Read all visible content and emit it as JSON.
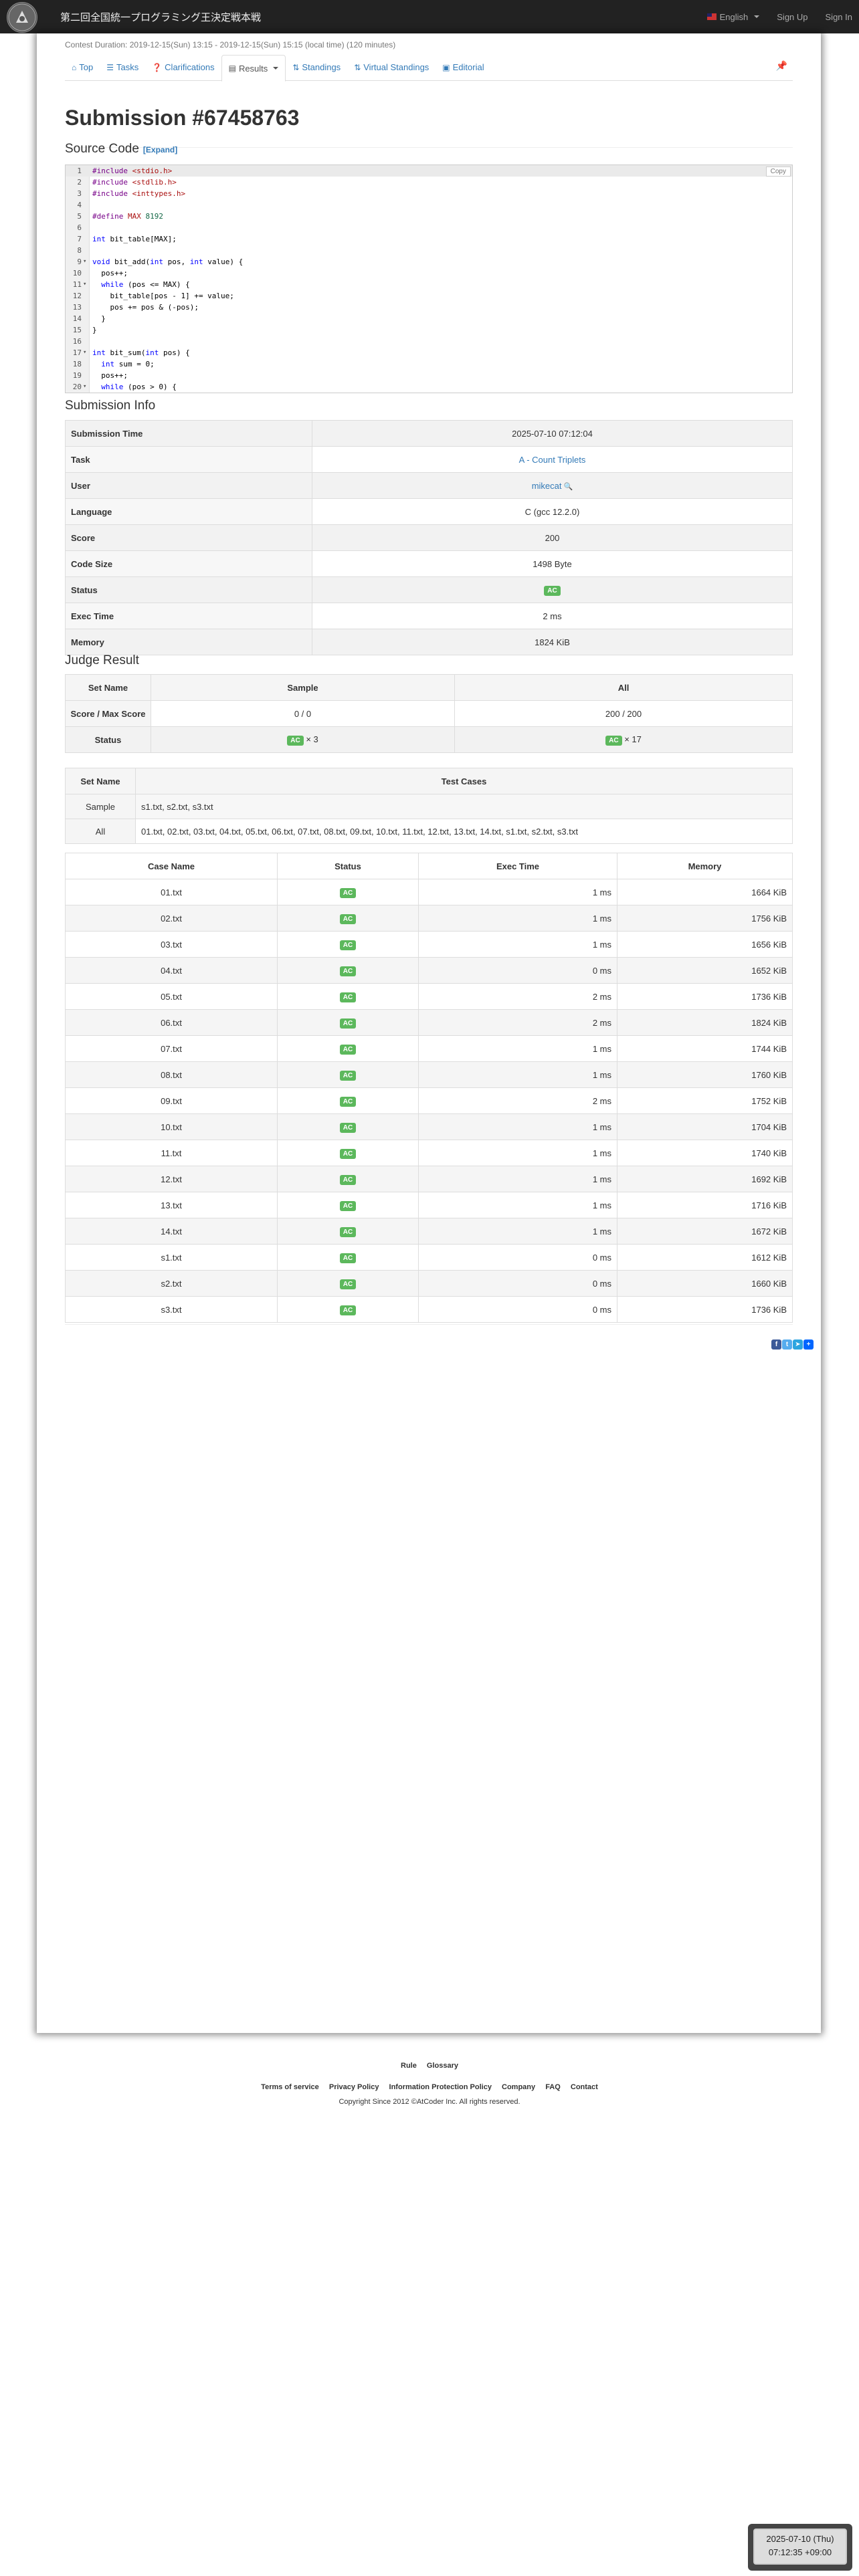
{
  "nav": {
    "brand": "第二回全国統一プログラミング王決定戦本戦",
    "language": "English",
    "sign_up": "Sign Up",
    "sign_in": "Sign In"
  },
  "contest": {
    "duration": "Contest Duration: 2019-12-15(Sun) 13:15 - 2019-12-15(Sun) 15:15 (local time) (120 minutes)"
  },
  "tabs": [
    {
      "label": "Top",
      "icon": "home-icon"
    },
    {
      "label": "Tasks",
      "icon": "list-icon"
    },
    {
      "label": "Clarifications",
      "icon": "question-icon"
    },
    {
      "label": "Results",
      "icon": "list-alt-icon"
    },
    {
      "label": "Standings",
      "icon": "sort-icon"
    },
    {
      "label": "Virtual Standings",
      "icon": "sort-icon"
    },
    {
      "label": "Editorial",
      "icon": "book-icon"
    }
  ],
  "page": {
    "title": "Submission #67458763",
    "source_heading": "Source Code",
    "expand": "[Expand]",
    "copy": "Copy",
    "info_heading": "Submission Info",
    "judge_heading": "Judge Result"
  },
  "code_lines": [
    "#include <stdio.h>",
    "#include <stdlib.h>",
    "#include <inttypes.h>",
    "",
    "#define MAX 8192",
    "",
    "int bit_table[MAX];",
    "",
    "void bit_add(int pos, int value) {",
    "  pos++;",
    "  while (pos <= MAX) {",
    "    bit_table[pos - 1] += value;",
    "    pos += pos & (-pos);",
    "  }",
    "}",
    "",
    "int bit_sum(int pos) {",
    "  int sum = 0;",
    "  pos++;",
    "  while (pos > 0) {"
  ],
  "submission_info": {
    "rows": [
      {
        "label": "Submission Time",
        "value": "2025-07-10 07:12:04"
      },
      {
        "label": "Task",
        "value": "A - Count Triplets"
      },
      {
        "label": "User",
        "value": "mikecat"
      },
      {
        "label": "Language",
        "value": "C (gcc 12.2.0)"
      },
      {
        "label": "Score",
        "value": "200"
      },
      {
        "label": "Code Size",
        "value": "1498 Byte"
      },
      {
        "label": "Status",
        "value": "AC"
      },
      {
        "label": "Exec Time",
        "value": "2 ms"
      },
      {
        "label": "Memory",
        "value": "1824 KiB"
      }
    ]
  },
  "judge": {
    "headers": [
      "Set Name",
      "Sample",
      "All"
    ],
    "score_label": "Score / Max Score",
    "sample_score": "0 / 0",
    "all_score": "200 / 200",
    "status_label": "Status",
    "sample_status": "AC",
    "sample_count": "× 3",
    "all_status": "AC",
    "all_count": "× 17"
  },
  "sets": {
    "headers": [
      "Set Name",
      "Test Cases"
    ],
    "rows": [
      {
        "name": "Sample",
        "cases": "s1.txt, s2.txt, s3.txt"
      },
      {
        "name": "All",
        "cases": "01.txt, 02.txt, 03.txt, 04.txt, 05.txt, 06.txt, 07.txt, 08.txt, 09.txt, 10.txt, 11.txt, 12.txt, 13.txt, 14.txt, s1.txt, s2.txt, s3.txt"
      }
    ]
  },
  "cases": {
    "headers": [
      "Case Name",
      "Status",
      "Exec Time",
      "Memory"
    ],
    "rows": [
      {
        "name": "01.txt",
        "status": "AC",
        "time": "1 ms",
        "memory": "1664 KiB"
      },
      {
        "name": "02.txt",
        "status": "AC",
        "time": "1 ms",
        "memory": "1756 KiB"
      },
      {
        "name": "03.txt",
        "status": "AC",
        "time": "1 ms",
        "memory": "1656 KiB"
      },
      {
        "name": "04.txt",
        "status": "AC",
        "time": "0 ms",
        "memory": "1652 KiB"
      },
      {
        "name": "05.txt",
        "status": "AC",
        "time": "2 ms",
        "memory": "1736 KiB"
      },
      {
        "name": "06.txt",
        "status": "AC",
        "time": "2 ms",
        "memory": "1824 KiB"
      },
      {
        "name": "07.txt",
        "status": "AC",
        "time": "1 ms",
        "memory": "1744 KiB"
      },
      {
        "name": "08.txt",
        "status": "AC",
        "time": "1 ms",
        "memory": "1760 KiB"
      },
      {
        "name": "09.txt",
        "status": "AC",
        "time": "2 ms",
        "memory": "1752 KiB"
      },
      {
        "name": "10.txt",
        "status": "AC",
        "time": "1 ms",
        "memory": "1704 KiB"
      },
      {
        "name": "11.txt",
        "status": "AC",
        "time": "1 ms",
        "memory": "1740 KiB"
      },
      {
        "name": "12.txt",
        "status": "AC",
        "time": "1 ms",
        "memory": "1692 KiB"
      },
      {
        "name": "13.txt",
        "status": "AC",
        "time": "1 ms",
        "memory": "1716 KiB"
      },
      {
        "name": "14.txt",
        "status": "AC",
        "time": "1 ms",
        "memory": "1672 KiB"
      },
      {
        "name": "s1.txt",
        "status": "AC",
        "time": "0 ms",
        "memory": "1612 KiB"
      },
      {
        "name": "s2.txt",
        "status": "AC",
        "time": "0 ms",
        "memory": "1660 KiB"
      },
      {
        "name": "s3.txt",
        "status": "AC",
        "time": "0 ms",
        "memory": "1736 KiB"
      }
    ]
  },
  "footer": {
    "links1": [
      "Rule",
      "Glossary"
    ],
    "links2": [
      "Terms of service",
      "Privacy Policy",
      "Information Protection Policy",
      "Company",
      "FAQ",
      "Contact"
    ],
    "copyright": "Copyright Since 2012 ©AtCoder Inc. All rights reserved."
  },
  "clock": {
    "date": "2025-07-10 (Thu)",
    "time": "07:12:35 +09:00"
  },
  "colors": {
    "ac": "#5cb85c",
    "link": "#337ab7",
    "navbar": "#222222"
  }
}
